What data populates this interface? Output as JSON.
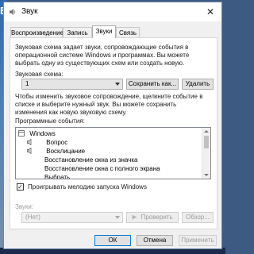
{
  "window": {
    "title": "Звук",
    "close_glyph": "✕"
  },
  "tabs": [
    {
      "label": "Воспроизведение"
    },
    {
      "label": "Запись"
    },
    {
      "label": "Звуки"
    },
    {
      "label": "Связь"
    }
  ],
  "sounds": {
    "description": [
      "Звуковая схема задает звуки, сопровождающие события в",
      "операционной системе Windows и программах. Вы можете",
      "выбрать одну из существующих схем или создать новую."
    ],
    "scheme_label": "Звуковая схема:",
    "scheme_value": "1",
    "save_as_label": "Сохранить как...",
    "delete_label": "Удалить",
    "instructions": [
      "Чтобы изменить звуковое сопровождение, щелкните событие в",
      "списке и выберите нужный звук. Вы можете сохранить",
      "изменения как новую звуковую схему."
    ],
    "events_label": "Программные события:",
    "events": [
      {
        "label": "Windows",
        "type": "group"
      },
      {
        "label": "Вопрос",
        "type": "sound"
      },
      {
        "label": "Восклицание",
        "type": "sound"
      },
      {
        "label": "Восстановление окна из значка",
        "type": "none"
      },
      {
        "label": "Восстановление окна с полного экрана",
        "type": "none"
      },
      {
        "label": "Выбрать",
        "type": "none"
      }
    ],
    "startup_checkbox_label": "Проигрывать мелодию запуска Windows",
    "startup_checked": true,
    "sounds_label": "Звуки:",
    "sound_value": "(Нет)",
    "test_label": "Проверить",
    "browse_label": "Обзор..."
  },
  "footer": {
    "ok": "ОК",
    "cancel": "Отмена",
    "apply": "Применить"
  },
  "colors": {
    "accent": "#0078d7",
    "background": "#3c5a82"
  }
}
